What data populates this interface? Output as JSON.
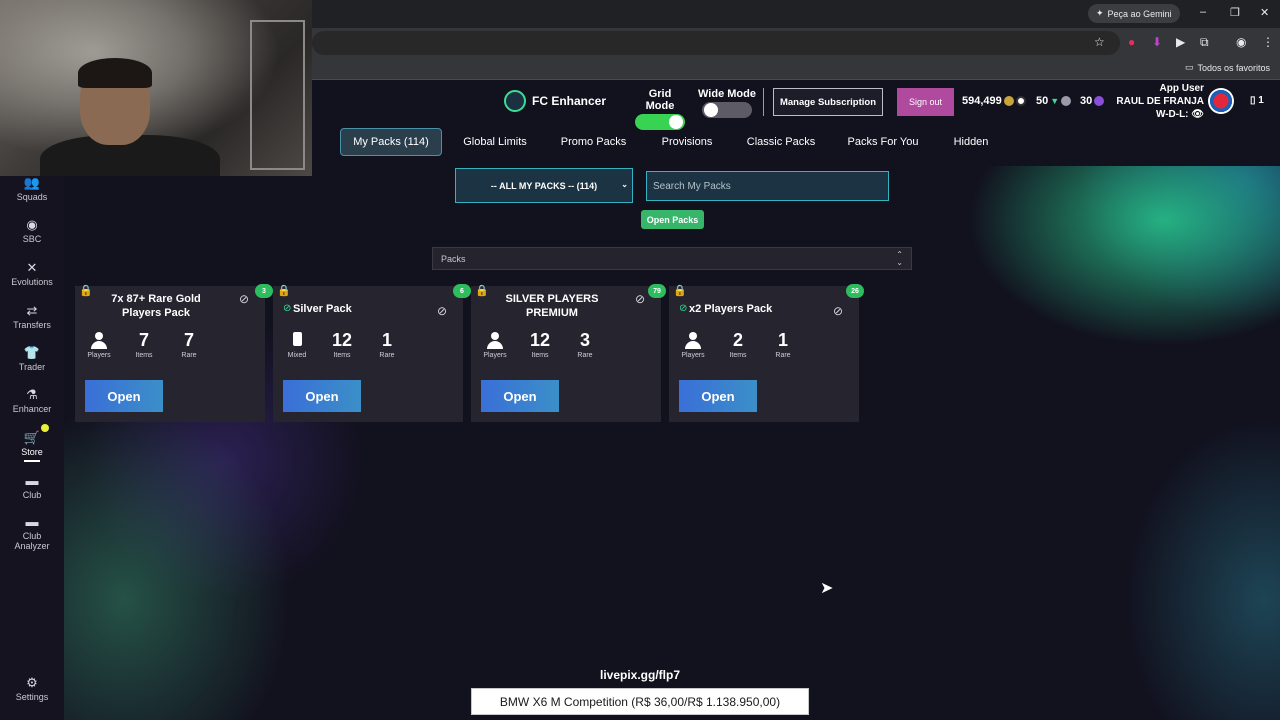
{
  "browser": {
    "gemini_label": "Peça ao Gemini",
    "favorites_label": "Todos os favoritos"
  },
  "app": {
    "brand": "FC Enhancer",
    "grid_mode_label": "Grid Mode",
    "grid_mode_on": true,
    "wide_mode_label": "Wide Mode",
    "wide_mode_on": false,
    "manage_subscription": "Manage Subscription",
    "sign_out": "Sign out",
    "coins": "594,499",
    "points_a": "50",
    "points_b": "30",
    "user_line1": "App User",
    "user_line2": "RAUL DE FRANJA",
    "user_line3": "W-D-L:",
    "phone_count": "1"
  },
  "sidebar": {
    "items": [
      {
        "label": "Squads",
        "icon": "squads-icon"
      },
      {
        "label": "SBC",
        "icon": "sbc-icon"
      },
      {
        "label": "Evolutions",
        "icon": "evolutions-icon"
      },
      {
        "label": "Transfers",
        "icon": "transfers-icon"
      },
      {
        "label": "Trader",
        "icon": "trader-icon"
      },
      {
        "label": "Enhancer",
        "icon": "enhancer-icon"
      },
      {
        "label": "Store",
        "icon": "store-icon"
      },
      {
        "label": "Club",
        "icon": "club-icon"
      },
      {
        "label": "Club Analyzer",
        "icon": "club-analyzer-icon"
      },
      {
        "label": "Settings",
        "icon": "settings-icon"
      }
    ]
  },
  "tabs": [
    {
      "label": "My Packs (114)"
    },
    {
      "label": "Global Limits"
    },
    {
      "label": "Promo Packs"
    },
    {
      "label": "Provisions"
    },
    {
      "label": "Classic Packs"
    },
    {
      "label": "Packs For You"
    },
    {
      "label": "Hidden"
    }
  ],
  "filters": {
    "select_value": "-- ALL MY PACKS -- (114)",
    "search_placeholder": "Search My Packs",
    "open_packs": "Open Packs",
    "packs_select_value": "Packs"
  },
  "cards": [
    {
      "title": "7x 87+ Rare Gold Players Pack",
      "count": "3",
      "stats": [
        {
          "value": "",
          "label": "Players"
        },
        {
          "value": "7",
          "label": "Items"
        },
        {
          "value": "7",
          "label": "Rare"
        }
      ],
      "open": "Open"
    },
    {
      "title": "Silver Pack",
      "count": "6",
      "stats": [
        {
          "value": "",
          "label": "Mixed"
        },
        {
          "value": "12",
          "label": "Items"
        },
        {
          "value": "1",
          "label": "Rare"
        }
      ],
      "open": "Open"
    },
    {
      "title": "SILVER PLAYERS PREMIUM",
      "count": "79",
      "stats": [
        {
          "value": "",
          "label": "Players"
        },
        {
          "value": "12",
          "label": "Items"
        },
        {
          "value": "3",
          "label": "Rare"
        }
      ],
      "open": "Open"
    },
    {
      "title": "x2 Players Pack",
      "count": "26",
      "stats": [
        {
          "value": "",
          "label": "Players"
        },
        {
          "value": "2",
          "label": "Items"
        },
        {
          "value": "1",
          "label": "Rare"
        }
      ],
      "open": "Open"
    }
  ],
  "overlay": {
    "livepix": "livepix.gg/flp7",
    "donation": "BMW X6 M Competition (R$ 36,00/R$ 1.138.950,00)"
  }
}
